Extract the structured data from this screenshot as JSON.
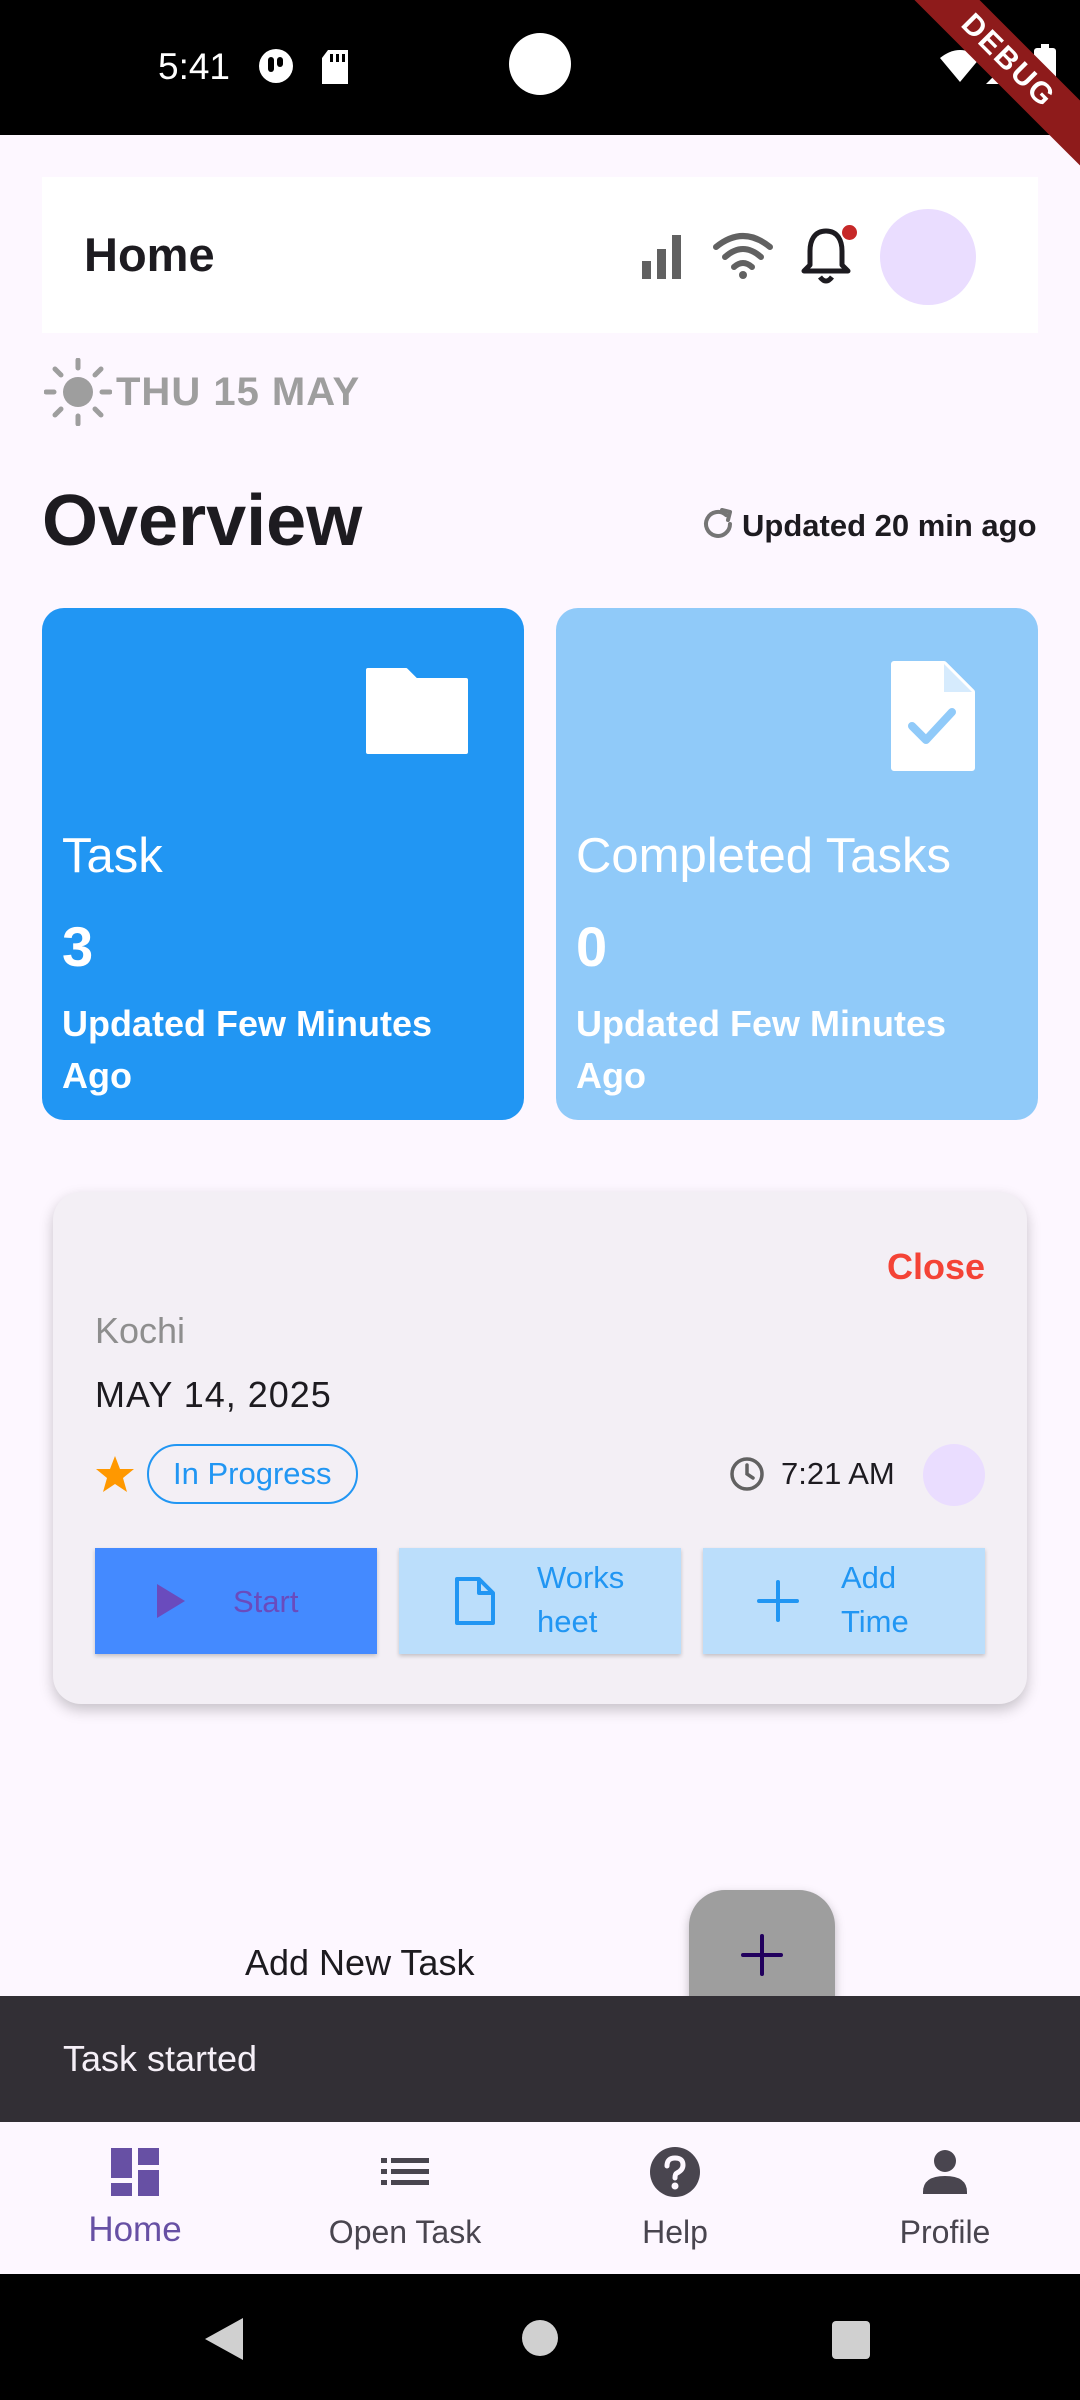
{
  "status_bar": {
    "time": "5:41",
    "debug_banner": "DEBUG"
  },
  "app_bar": {
    "title": "Home"
  },
  "date": "THU 15 MAY",
  "overview": {
    "title": "Overview",
    "updated": "Updated 20 min ago"
  },
  "stats": [
    {
      "title": "Task",
      "count": "3",
      "updated": "Updated Few Minutes Ago",
      "icon": "folder-icon",
      "color": "#2196f3"
    },
    {
      "title": "Completed Tasks",
      "count": "0",
      "updated": "Updated Few Minutes Ago",
      "icon": "task-check-icon",
      "color": "#90caf9"
    }
  ],
  "task": {
    "close_label": "Close",
    "location": "Kochi",
    "date": "MAY 14, 2025",
    "status": "In Progress",
    "time": "7:21 AM",
    "actions": [
      {
        "label": "Start",
        "icon": "play-icon"
      },
      {
        "label": "Works heet",
        "icon": "document-icon"
      },
      {
        "label": "Add Time",
        "icon": "plus-icon"
      }
    ]
  },
  "add_task_label": "Add New Task",
  "snackbar": "Task started",
  "bottom_nav": [
    {
      "label": "Home",
      "icon": "dashboard-icon",
      "active": true
    },
    {
      "label": "Open Task",
      "icon": "list-icon",
      "active": false
    },
    {
      "label": "Help",
      "icon": "help-icon",
      "active": false
    },
    {
      "label": "Profile",
      "icon": "person-icon",
      "active": false
    }
  ],
  "colors": {
    "primary": "#6750a4",
    "accent_blue": "#2196f3",
    "close_red": "#f44336",
    "star": "#ff9800"
  }
}
